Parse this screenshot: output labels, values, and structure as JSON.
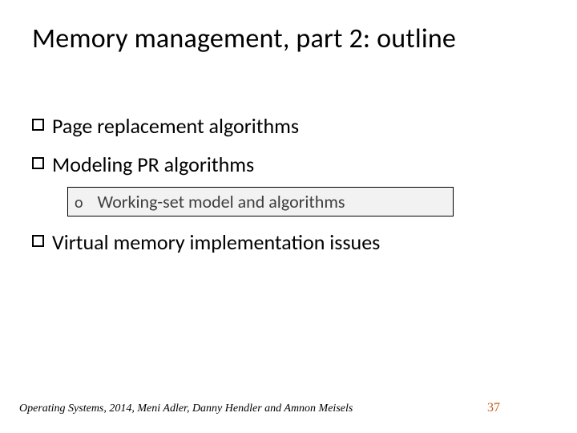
{
  "title": "Memory management, part 2: outline",
  "items": {
    "i0": "Page replacement algorithms",
    "i1": "Modeling PR algorithms",
    "sub0_marker": "o",
    "sub0": "Working-set model and algorithms",
    "i2": "Virtual memory implementation issues"
  },
  "footer": {
    "credit": "Operating Systems, 2014, Meni Adler, Danny Hendler and Amnon Meisels",
    "page": "37"
  }
}
